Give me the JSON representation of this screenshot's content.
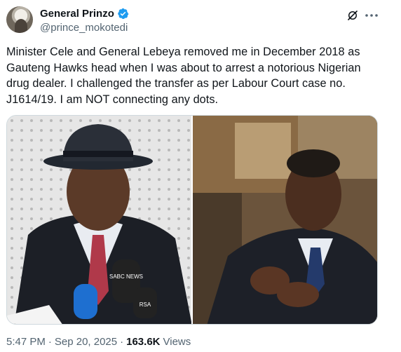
{
  "author": {
    "display_name": "General Prinzo",
    "handle": "@prince_mokotedi",
    "verified": true
  },
  "tweet": {
    "text": "Minister Cele and General Lebeya removed me in December 2018 as Gauteng Hawks head when I was about to arrest a notorious Nigerian drug dealer. I challenged the transfer as per Labour Court case no. J1614/19. I am NOT connecting any dots."
  },
  "media": {
    "left_photo_mic_labels": [
      "SABC NEWS",
      "RSA"
    ],
    "right_photo": "man in suit gesturing"
  },
  "meta": {
    "time": "5:47 PM",
    "date": "Sep 20, 2025",
    "separator": "·",
    "views_count": "163.6K",
    "views_label": "Views"
  },
  "icons": {
    "verified": "verified-badge-icon",
    "grok": "grok-icon",
    "more": "more-icon"
  },
  "colors": {
    "verified_blue": "#1d9bf0",
    "text_primary": "#0f1419",
    "text_secondary": "#536471"
  }
}
